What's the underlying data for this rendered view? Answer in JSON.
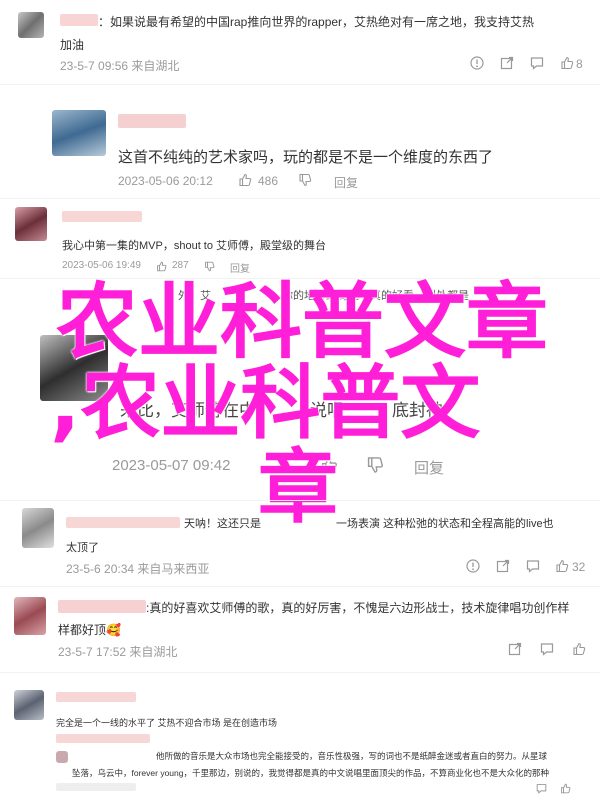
{
  "comments": [
    {
      "text_line1": "：如果说最有希望的中国rap推向世界的rapper，艾热绝对有一席之地，我支持艾热",
      "text_line2": "加油",
      "date": "23-5-7 09:56 来自湖北",
      "likes": "8"
    },
    {
      "text_line1": "这首不纯纯的艺术家吗，玩的都是不是一个维度的东西了",
      "date": "2023-05-06 20:12",
      "likes": "486",
      "reply_label": "回复"
    },
    {
      "text_line1": "我心中第一集的MVP，shout to 艾师傅，殿堂级的舞台",
      "date": "2023-05-06 19:49",
      "likes": "287",
      "reply_label": "回复"
    },
    {
      "text_line1": "外，艾",
      "text_line1b": "你的地方结局现场真的好看，到处都是",
      "text_line2": "来比，艾师傅在中",
      "text_line2b": "说唱",
      "text_line2c": "底封神",
      "date": "2023-05-07 09:42",
      "reply_label": "回复"
    },
    {
      "text_line1a": "天呐！这还只是",
      "text_line1b": "一场表演 这种松弛的状态和全程高能的live也",
      "text_line2": "太顶了",
      "date": "23-5-6 20:34 来自马来西亚",
      "likes": "32"
    },
    {
      "text_line1": ":真的好喜欢艾师傅的歌，真的好厉害，不愧是六边形战士，技术旋律唱功创作样",
      "text_line2": "样都好顶",
      "emoji": "🥰",
      "date": "23-5-7 17:52 来自湖北"
    },
    {
      "text_line1": "完全是一个一线的水平了 艾热不迎合市场 是在创造市场",
      "nested_line1": "他所做的音乐是大众市场也完全能接受的，音乐性极强，写的词也不是纸醉金迷或者直白的努力。从星球",
      "nested_line2": "坠落，乌云中，forever young，千里那边，别说的，我觉得都是真的中文说唱里面顶尖的作品，不算商业化也不是大众化的那种"
    }
  ],
  "overlay_title": {
    "line1": "农业科普文章",
    "line2": ",农业科普文",
    "line3": "章"
  },
  "colors": {
    "overlay": "#ff1fd8",
    "meta": "#9a9a9a",
    "text": "#333333"
  }
}
